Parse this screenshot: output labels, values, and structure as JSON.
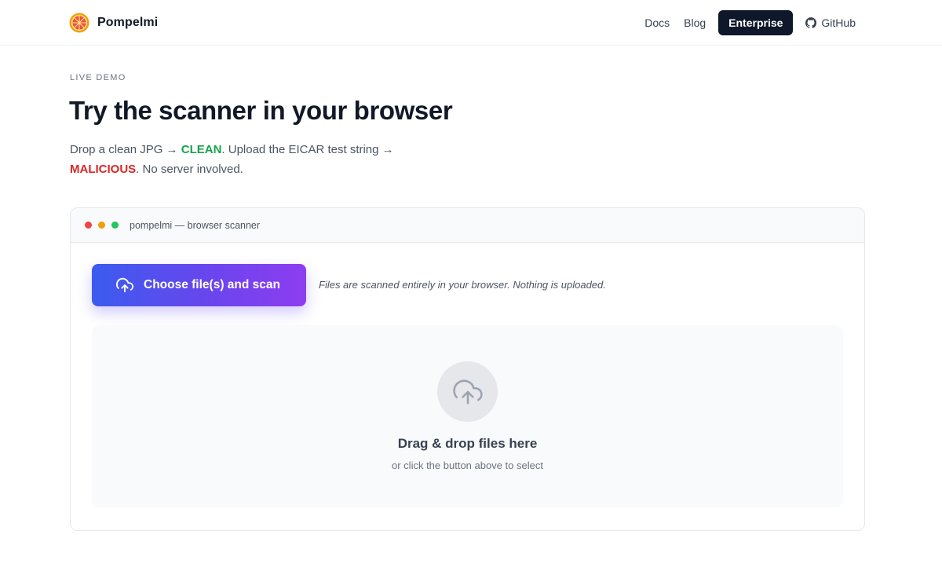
{
  "header": {
    "brand_name": "Pompelmi",
    "logo_icon": "grapefruit-logo",
    "nav": {
      "docs": "Docs",
      "blog": "Blog",
      "enterprise": "Enterprise",
      "github": "GitHub"
    }
  },
  "hero": {
    "eyebrow": "LIVE DEMO",
    "title": "Try the scanner in your browser",
    "subtitle": {
      "part1": "Drop a clean JPG → ",
      "clean": "CLEAN",
      "part2": ". Upload the EICAR test string → ",
      "malicious": "MALICIOUS",
      "part3": ". No server involved."
    }
  },
  "scanner": {
    "window_title": "pompelmi — browser scanner",
    "button_label": "Choose file(s) and scan",
    "button_icon": "upload-cloud-icon",
    "hint": "Files are scanned entirely in your browser. Nothing is uploaded.",
    "dropzone": {
      "icon": "upload-cloud-icon",
      "title": "Drag & drop files here",
      "subtitle": "or click the button above to select"
    }
  },
  "colors": {
    "clean": "#16a34a",
    "malicious": "#dc2626",
    "enterprise_bg": "#0f172a",
    "button_gradient_start": "#3b5bef",
    "button_gradient_end": "#8e3df0"
  }
}
